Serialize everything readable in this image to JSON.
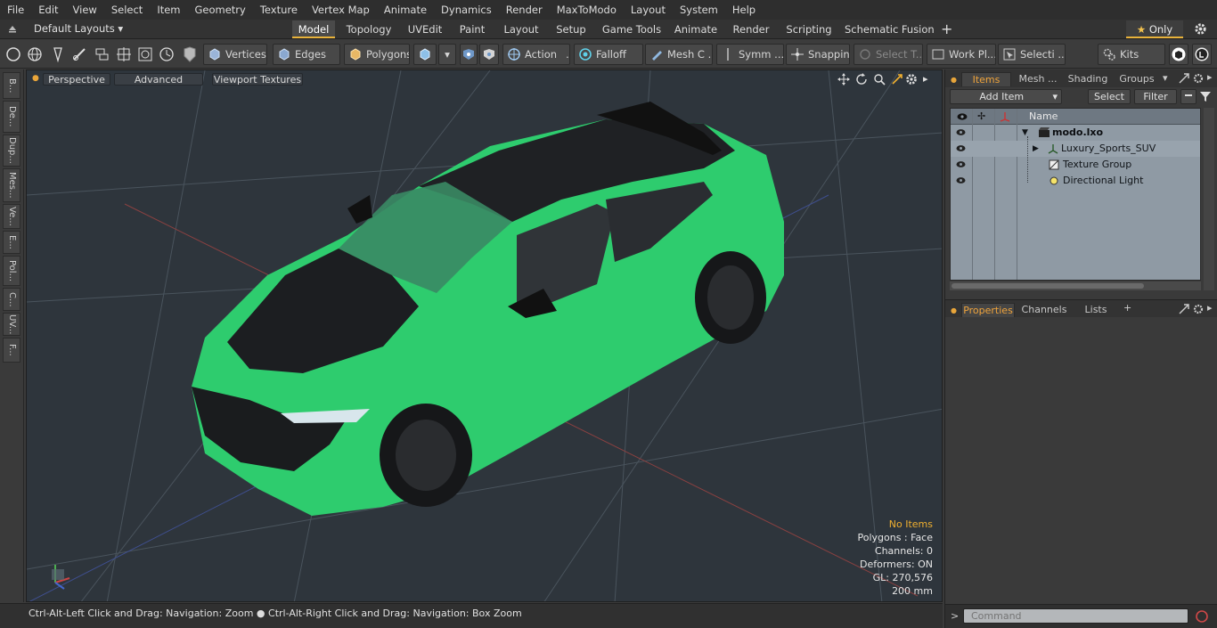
{
  "menu": [
    "File",
    "Edit",
    "View",
    "Select",
    "Item",
    "Geometry",
    "Texture",
    "Vertex Map",
    "Animate",
    "Dynamics",
    "Render",
    "MaxToModo",
    "Layout",
    "System",
    "Help"
  ],
  "layout_selector": "Default Layouts",
  "layout_tabs": [
    "Model",
    "Topology",
    "UVEdit",
    "Paint",
    "Layout",
    "Setup",
    "Game Tools",
    "Animate",
    "Render",
    "Scripting",
    "Schematic Fusion"
  ],
  "active_layout_tab": "Model",
  "only_label": "Only",
  "toolbar": {
    "vertices": "Vertices",
    "edges": "Edges",
    "polygons": "Polygons",
    "action": "Action",
    "falloff": "Falloff",
    "mesh": "Mesh C ...",
    "symmetry": "Symm ...",
    "snapping": "Snapping",
    "select_tool": "Select T...",
    "work_plane": "Work Pl...",
    "selection": "Selecti ...",
    "kits": "Kits"
  },
  "left_tabs": [
    "B...",
    "De...",
    "Dup...",
    "Mes...",
    "Ve...",
    "E...",
    "Pol...",
    "C...",
    "UV...",
    "F..."
  ],
  "viewport": {
    "perspective": "Perspective",
    "advanced": "Advanced",
    "textures": "Viewport Textures",
    "info": {
      "no_items": "No Items",
      "polygons": "Polygons : Face",
      "channels": "Channels: 0",
      "deformers": "Deformers: ON",
      "gl": "GL: 270,576",
      "scale": "200 mm"
    }
  },
  "status": {
    "left": "Ctrl-Alt-Left Click and Drag: Navigation: Zoom",
    "right": "Ctrl-Alt-Right Click and Drag: Navigation: Box Zoom"
  },
  "items_panel": {
    "tabs": [
      "Items",
      "Mesh ...",
      "Shading",
      "Groups"
    ],
    "add_item": "Add Item",
    "select": "Select",
    "filter": "Filter",
    "column_name": "Name",
    "tree": [
      {
        "label": "modo.lxo",
        "bold": true
      },
      {
        "label": "Luxury_Sports_SUV"
      },
      {
        "label": "Texture Group"
      },
      {
        "label": "Directional Light"
      }
    ]
  },
  "props_panel": {
    "tabs": [
      "Properties",
      "Channels",
      "Lists"
    ]
  },
  "command_placeholder": "Command",
  "colors": {
    "accent": "#f0a43c",
    "car": "#2ecc6e",
    "viewport_bg": "#2e353c"
  }
}
